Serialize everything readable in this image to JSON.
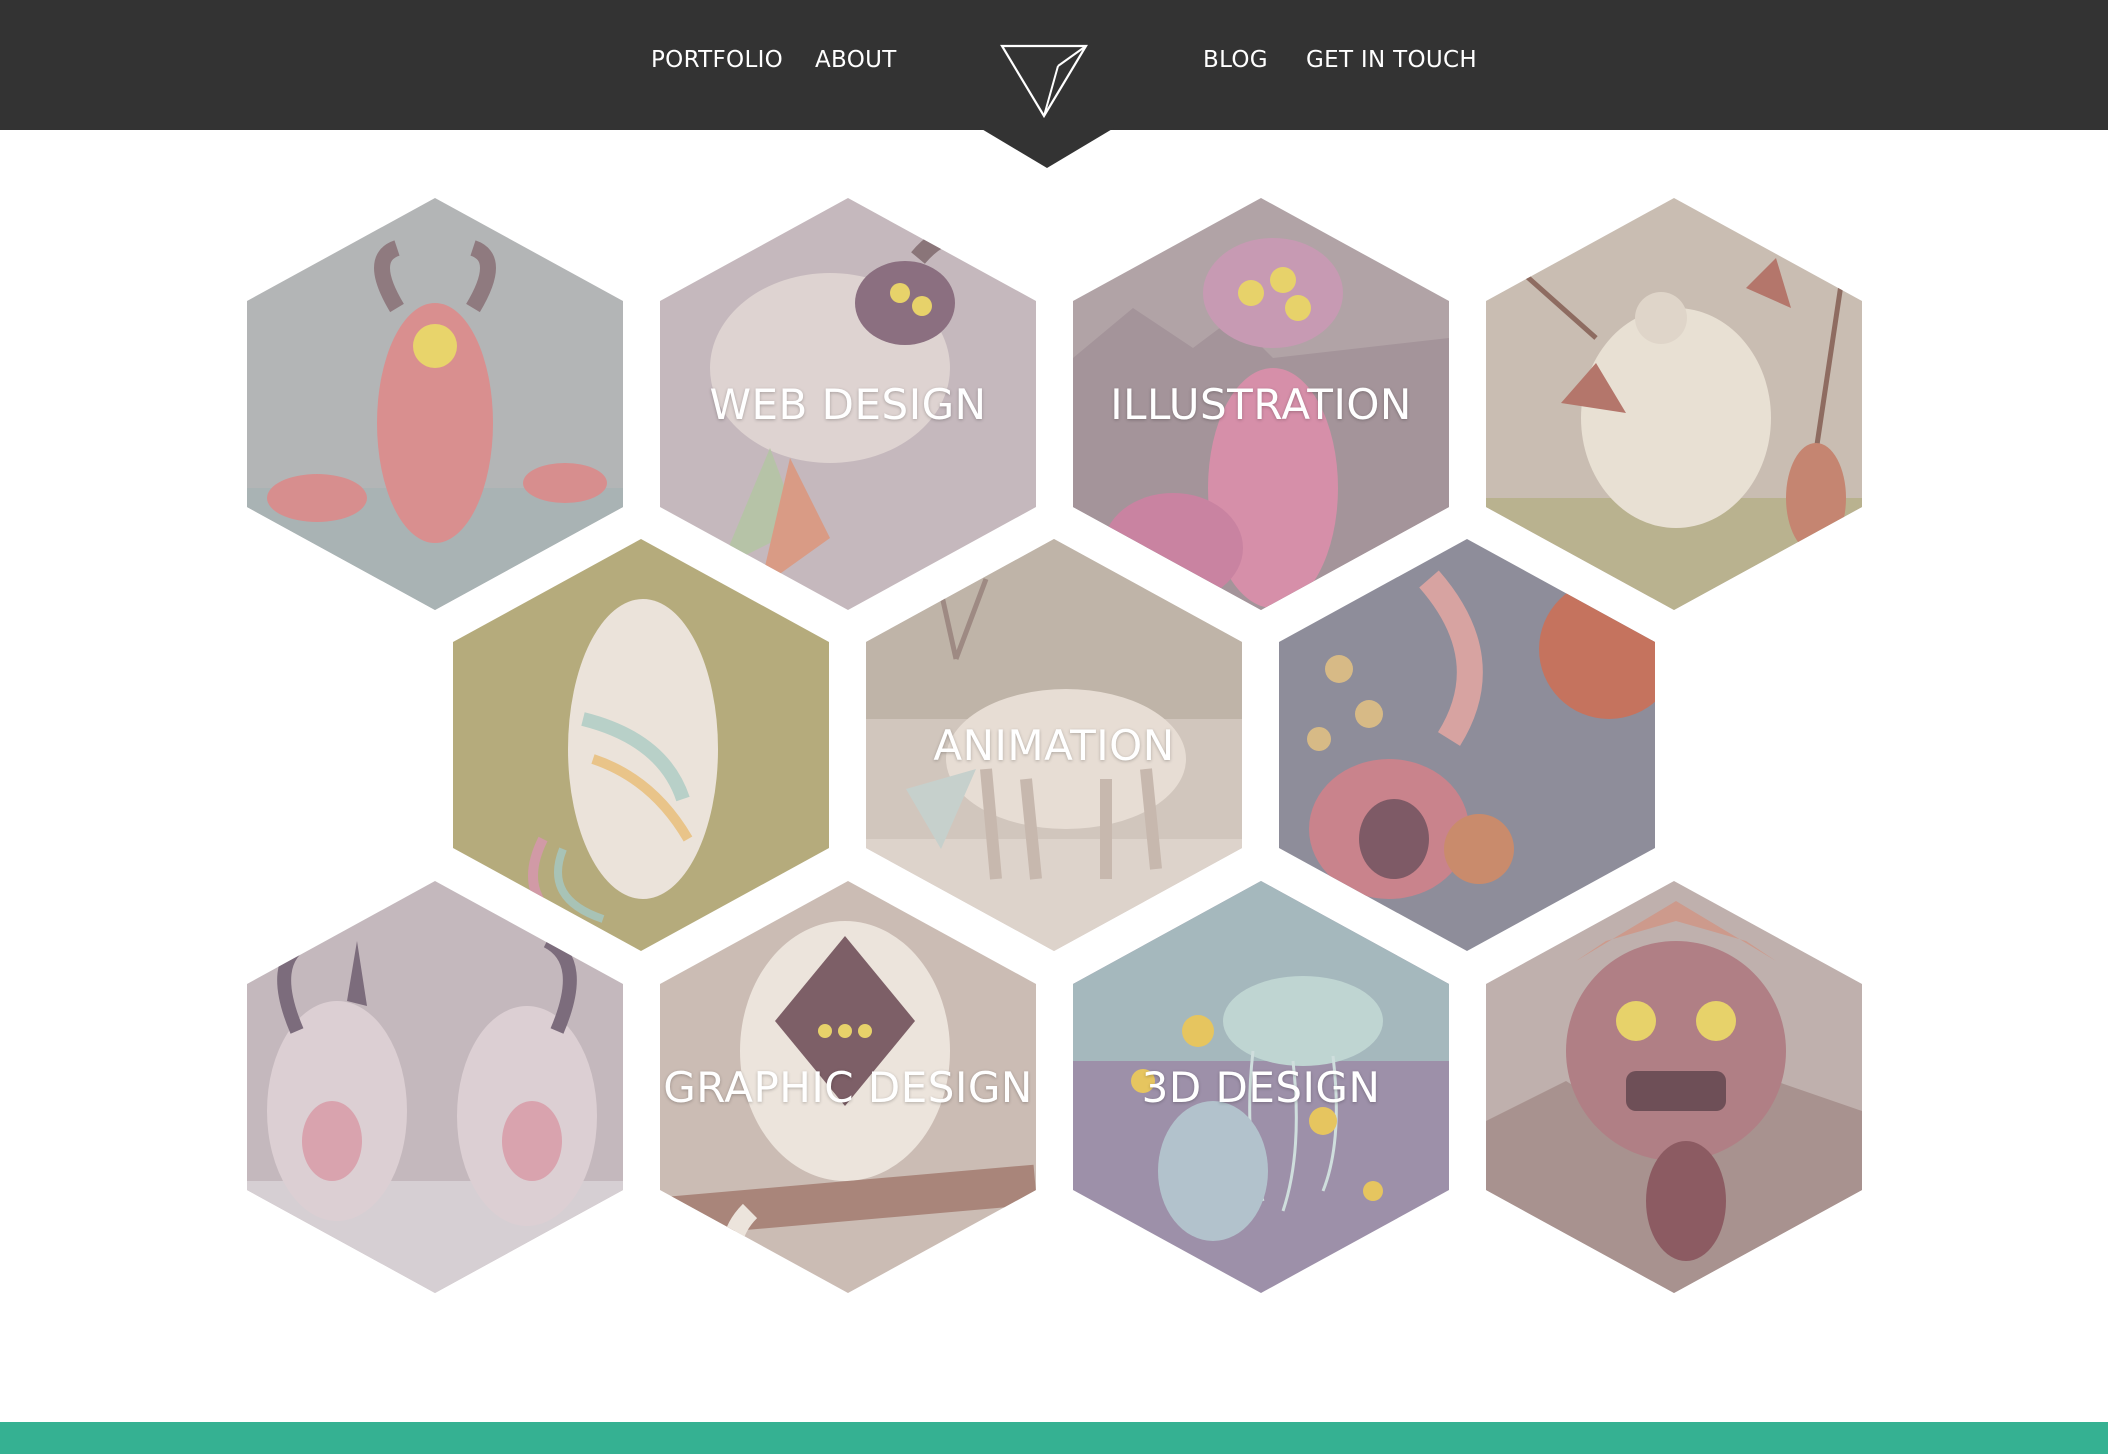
{
  "nav": {
    "left": [
      "PORTFOLIO",
      "ABOUT"
    ],
    "right": [
      "BLOG",
      "GET IN TOUCH"
    ],
    "logo_icon": "triangle-down-icon"
  },
  "colors": {
    "header": "#333333",
    "accent": "#35b192",
    "label": "#ffffff"
  },
  "tiles": [
    {
      "label": "",
      "bg": "#b9a9ab"
    },
    {
      "label": "WEB DESIGN",
      "bg": "#c9b7bb"
    },
    {
      "label": "ILLUSTRATION",
      "bg": "#b7969c"
    },
    {
      "label": "",
      "bg": "#c8b7ad"
    },
    {
      "label": "",
      "bg": "#b5a77f"
    },
    {
      "label": "ANIMATION",
      "bg": "#d4c2b7"
    },
    {
      "label": "",
      "bg": "#a58993"
    },
    {
      "label": "",
      "bg": "#c8b5bb"
    },
    {
      "label": "GRAPHIC DESIGN",
      "bg": "#cdbab2"
    },
    {
      "label": "3D DESIGN",
      "bg": "#9a8ea6"
    },
    {
      "label": "",
      "bg": "#b89d9f"
    }
  ]
}
